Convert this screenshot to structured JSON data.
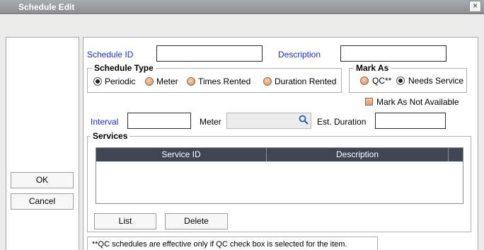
{
  "window": {
    "title": "Schedule Edit",
    "close_glyph": "×"
  },
  "actions": {
    "ok": "OK",
    "cancel": "Cancel"
  },
  "form": {
    "schedule_id_label": "Schedule ID",
    "schedule_id_value": "",
    "description_label": "Description",
    "description_value": "",
    "schedule_type": {
      "legend": "Schedule Type",
      "options": [
        "Periodic",
        "Meter",
        "Times Rented",
        "Duration Rented"
      ],
      "selected": "Periodic"
    },
    "mark_as": {
      "legend": "Mark As",
      "options": [
        "QC**",
        "Needs Service"
      ],
      "selected": "Needs Service"
    },
    "mark_not_available_label": "Mark As Not Available",
    "interval_label": "Interval",
    "interval_value": "",
    "meter_label": "Meter",
    "meter_value": "",
    "est_duration_label": "Est. Duration",
    "est_duration_value": ""
  },
  "services": {
    "legend": "Services",
    "columns": [
      "Service ID",
      "Description"
    ],
    "rows": [],
    "list_button": "List",
    "delete_button": "Delete"
  },
  "footnote": "**QC schedules are effective only if QC check box is selected for the item.",
  "colors": {
    "label_blue": "#1a2fd1",
    "grid_header": "#3f4552"
  }
}
